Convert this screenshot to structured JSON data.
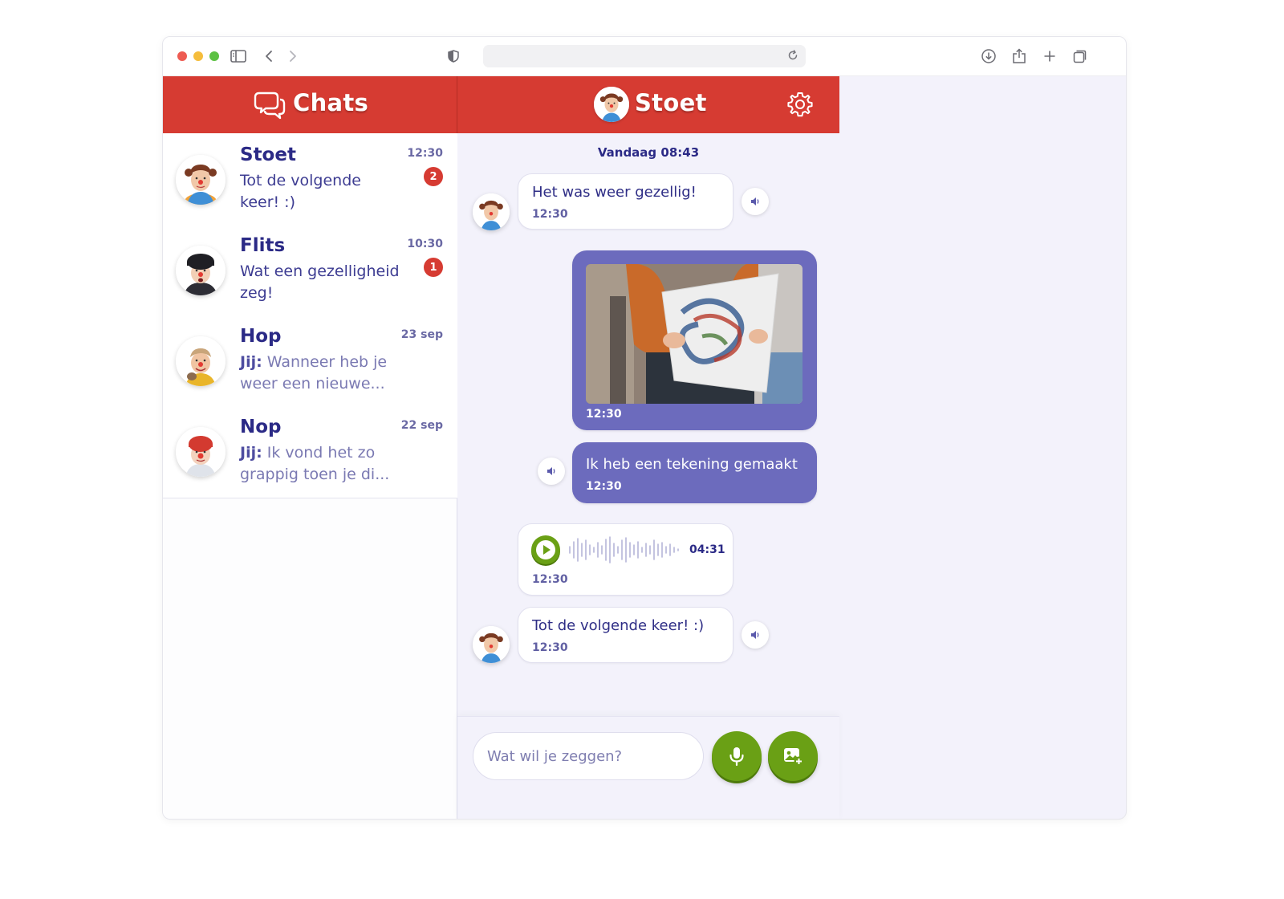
{
  "sidebar": {
    "title": "Chats",
    "conversations": [
      {
        "name": "Stoet",
        "preview": "Tot de volgende keer! :)",
        "time": "12:30",
        "badge": "2"
      },
      {
        "name": "Flits",
        "preview": "Wat een gezelligheid zeg!",
        "time": "10:30",
        "badge": "1"
      },
      {
        "name": "Hop",
        "preview_prefix": "Jij:",
        "preview": "Wanneer heb je weer een nieuwe...",
        "time": "23 sep"
      },
      {
        "name": "Nop",
        "preview_prefix": "Jij:",
        "preview": "Ik vond het zo grappig toen je di...",
        "time": "22 sep"
      }
    ]
  },
  "chat": {
    "title": "Stoet",
    "date_separator": "Vandaag 08:43",
    "messages": [
      {
        "type": "text",
        "direction": "in",
        "text": "Het was weer gezellig!",
        "time": "12:30"
      },
      {
        "type": "image",
        "direction": "out",
        "time": "12:30"
      },
      {
        "type": "text",
        "direction": "out",
        "text": "Ik heb een tekening gemaakt",
        "time": "12:30"
      },
      {
        "type": "audio",
        "direction": "in",
        "duration": "04:31",
        "time": "12:30"
      },
      {
        "type": "text",
        "direction": "in",
        "text": "Tot de volgende keer! :)",
        "time": "12:30"
      }
    ],
    "composer": {
      "placeholder": "Wat wil je zeggen?"
    }
  },
  "colors": {
    "header": "#d63b32",
    "accent": "#6c6bbd",
    "text": "#2b2a86",
    "green": "#6aa015"
  }
}
